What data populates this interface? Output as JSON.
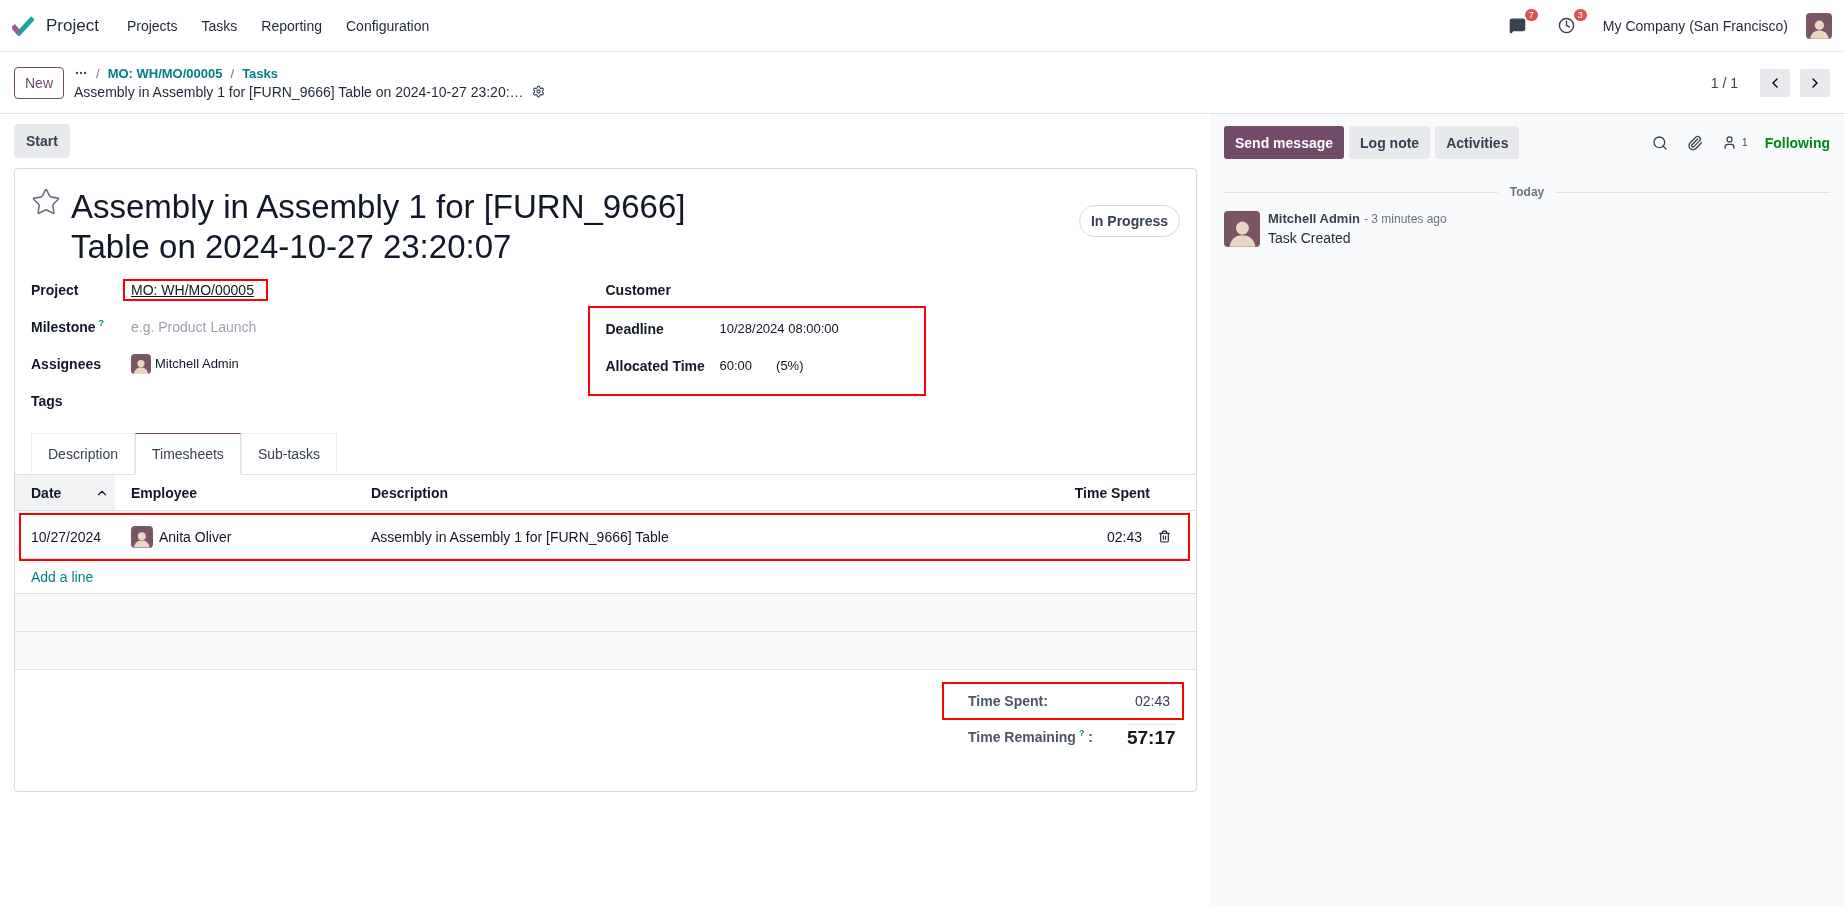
{
  "navbar": {
    "app": "Project",
    "menu": [
      "Projects",
      "Tasks",
      "Reporting",
      "Configuration"
    ],
    "messages_badge": "7",
    "activities_badge": "3",
    "company": "My Company (San Francisco)"
  },
  "control_panel": {
    "new_button": "New",
    "breadcrumbs": [
      "MO: WH/MO/00005",
      "Tasks"
    ],
    "separator": "/",
    "record_title": "Assembly in Assembly 1 for [FURN_9666] Table on 2024-10-27 23:20:…",
    "pager": "1 / 1"
  },
  "statusbar_buttons": [
    "Start"
  ],
  "task": {
    "starred": false,
    "title_lines": [
      "Assembly in Assembly 1 for [FURN_9666]",
      "Table on 2024-10-27 23:20:07"
    ],
    "stage": "In Progress",
    "left_fields": [
      {
        "label": "Project",
        "kind": "link",
        "value": "MO: WH/MO/00005",
        "highlighted": true
      },
      {
        "label": "Milestone",
        "help": "?",
        "kind": "input",
        "placeholder": "e.g. Product Launch",
        "highlighted": false
      },
      {
        "label": "Assignees",
        "kind": "user",
        "value": "Mitchell Admin",
        "highlighted": false
      },
      {
        "label": "Tags",
        "kind": "empty"
      }
    ],
    "customer": {
      "label": "Customer"
    },
    "schedule": {
      "highlighted": true,
      "fields": [
        {
          "label": "Deadline",
          "value": "10/28/2024 08:00:00"
        },
        {
          "label": "Allocated Time",
          "value": "60:00",
          "extra": "(5%)"
        }
      ]
    }
  },
  "tabs": [
    {
      "label": "Description",
      "selected": false
    },
    {
      "label": "Timesheets",
      "selected": true
    },
    {
      "label": "Sub-tasks",
      "selected": false
    }
  ],
  "timesheet": {
    "columns": [
      {
        "label": "Date",
        "sorted": true
      },
      {
        "label": "Employee",
        "sorted": false
      },
      {
        "label": "Description",
        "sorted": false
      },
      {
        "label": "Time Spent",
        "sorted": false
      }
    ],
    "rows": [
      {
        "date": "10/27/2024",
        "employee": "Anita Oliver",
        "description": "Assembly in Assembly 1 for [FURN_9666] Table",
        "time_spent": "02:43",
        "highlighted": true
      }
    ],
    "add_line": "Add a line",
    "total": {
      "label": "Time Spent:",
      "value": "02:43",
      "highlighted": true
    },
    "remaining": {
      "label": "Time Remaining",
      "help": "?",
      "separator": ":",
      "value": "57:17"
    }
  },
  "chatter": {
    "buttons": [
      {
        "label": "Send message",
        "kind": "primary"
      },
      {
        "label": "Log note",
        "kind": "secondary"
      },
      {
        "label": "Activities",
        "kind": "secondary"
      }
    ],
    "followers_count": "1",
    "following": "Following",
    "date_separator": "Today",
    "messages": [
      {
        "author": "Mitchell Admin",
        "time": "- 3 minutes ago",
        "body": "Task Created"
      }
    ]
  }
}
